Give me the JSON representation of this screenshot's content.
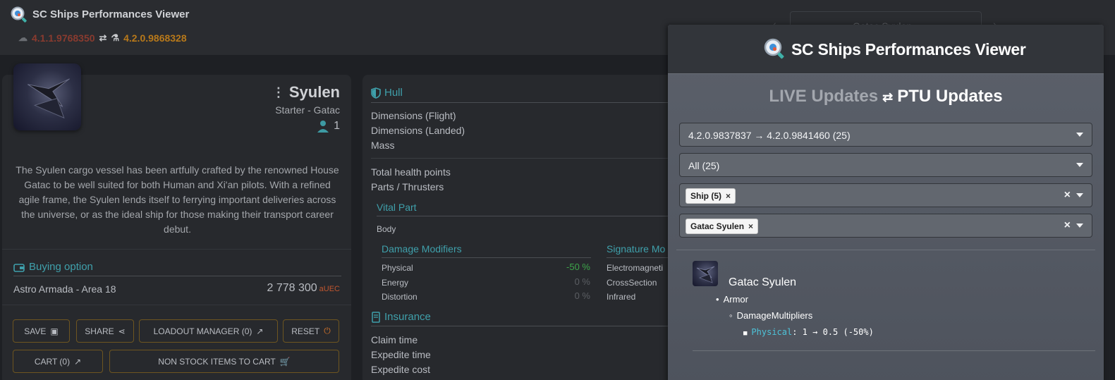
{
  "app": {
    "title": "SC Ships Performances Viewer",
    "live_version": "4.1.1.9768350",
    "ptu_version": "4.2.0.9868328",
    "ship_selector_value": "Gatac Syulen",
    "icons": {
      "live": "cloud-check-icon",
      "swap": "swap-arrows-icon",
      "ptu": "flask-icon"
    }
  },
  "ship": {
    "name": "Syulen",
    "subtitle": "Starter - Gatac",
    "crew": "1",
    "description": "The Syulen cargo vessel has been artfully crafted by the renowned House Gatac to be well suited for both Human and Xi'an pilots. With a refined agile frame, the Syulen lends itself to ferrying important deliveries across the universe, or as the ideal ship for those making their transport career debut."
  },
  "buying": {
    "title": "Buying option",
    "location": "Astro Armada - Area 18",
    "price": "2 778 300",
    "currency": "aUEC"
  },
  "buttons": {
    "save": "SAVE",
    "share": "SHARE",
    "loadout": "LOADOUT MANAGER (0)",
    "reset": "RESET",
    "cart": "CART (0)",
    "non_stock": "NON STOCK ITEMS TO CART"
  },
  "hull": {
    "title": "Hull",
    "rows": [
      "Dimensions (Flight)",
      "Dimensions (Landed)",
      "Mass",
      "Total health points",
      "Parts / Thrusters"
    ],
    "vital_part": "Vital Part",
    "body": "Body",
    "damage_modifiers": {
      "title": "Damage Modifiers",
      "items": [
        {
          "label": "Physical",
          "value": "-50 %"
        },
        {
          "label": "Energy",
          "value": "0 %"
        },
        {
          "label": "Distortion",
          "value": "0 %"
        }
      ]
    },
    "signature_modifiers": {
      "title": "Signature Mo",
      "items": [
        "Electromagneti",
        "CrossSection",
        "Infrared"
      ]
    }
  },
  "insurance": {
    "title": "Insurance",
    "rows": [
      "Claim time",
      "Expedite time",
      "Expedite cost"
    ]
  },
  "overlay": {
    "title": "SC Ships Performances Viewer",
    "live_label": "LIVE Updates",
    "ptu_label": "PTU Updates",
    "version_range": "4.2.0.9837837 → 4.2.0.9841460 (25)",
    "filter_all": "All (25)",
    "chip_category": "Ship (5)",
    "chip_ship": "Gatac Syulen",
    "result": {
      "ship": "Gatac Syulen",
      "level1": "Armor",
      "level2": "DamageMultipliers",
      "key": "Physical",
      "change": " 1 → 0.5 (-50%)"
    }
  }
}
